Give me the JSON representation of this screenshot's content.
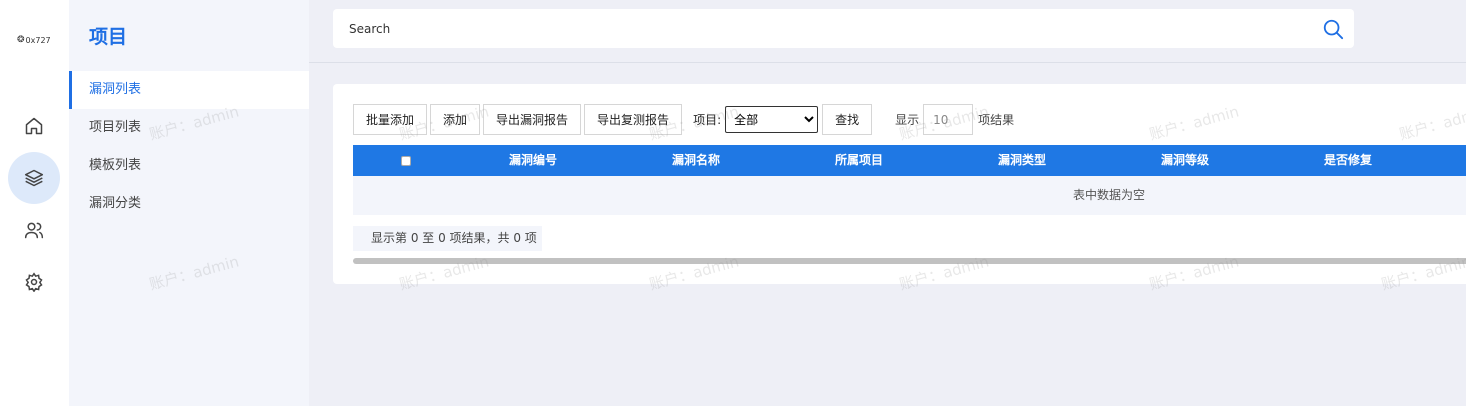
{
  "logo": {
    "text": "0x727"
  },
  "rail": {
    "items": [
      {
        "name": "home",
        "icon": "home-icon"
      },
      {
        "name": "layers",
        "icon": "layers-icon",
        "active": true
      },
      {
        "name": "users",
        "icon": "users-icon"
      },
      {
        "name": "settings",
        "icon": "gear-icon"
      }
    ]
  },
  "subnav": {
    "title": "项目",
    "items": [
      {
        "label": "漏洞列表",
        "active": true
      },
      {
        "label": "项目列表"
      },
      {
        "label": "模板列表"
      },
      {
        "label": "漏洞分类"
      }
    ]
  },
  "search": {
    "placeholder": "Search"
  },
  "toolbar": {
    "batch_add": "批量添加",
    "add": "添加",
    "export_vuln_report": "导出漏洞报告",
    "export_retest_report": "导出复测报告",
    "project_label": "项目:",
    "project_options": [
      "全部"
    ],
    "find": "查找",
    "show_label": "显示",
    "page_size": "10",
    "results_suffix": "项结果"
  },
  "table": {
    "columns": [
      "漏洞编号",
      "漏洞名称",
      "所属项目",
      "漏洞类型",
      "漏洞等级",
      "是否修复"
    ],
    "empty_text": "表中数据为空",
    "info": "显示第 0 至 0 项结果，共 0 项"
  },
  "watermark": {
    "text": "账户：admin"
  },
  "colors": {
    "accent": "#1f78e4",
    "accent_text": "#1f6fe4",
    "active_bg": "#dde9fa"
  }
}
